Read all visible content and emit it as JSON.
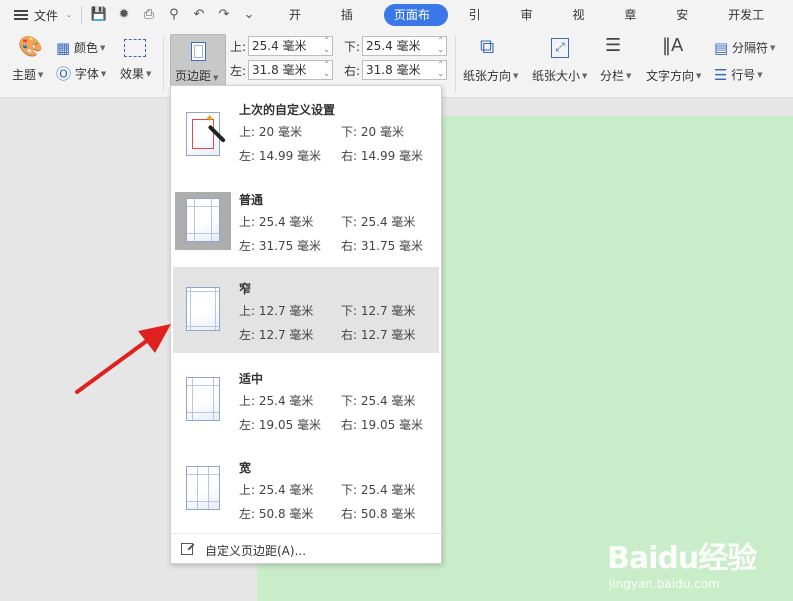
{
  "menubar": {
    "file_label": "文件",
    "tabs": [
      "开始",
      "插入",
      "页面布局",
      "引用",
      "审阅",
      "视图",
      "章节",
      "安全",
      "开发工具"
    ],
    "active_tab": "页面布局"
  },
  "ribbon": {
    "theme": "主题",
    "color": "颜色",
    "font": "字体",
    "effect": "效果",
    "margin": "页边距",
    "top_label": "上:",
    "bottom_label": "下:",
    "left_label": "左:",
    "right_label": "右:",
    "top_value": "25.4 毫米",
    "bottom_value": "25.4 毫米",
    "left_value": "31.8 毫米",
    "right_value": "31.8 毫米",
    "orientation": "纸张方向",
    "size": "纸张大小",
    "columns": "分栏",
    "text_direction": "文字方向",
    "separator": "分隔符",
    "line_number": "行号"
  },
  "dropdown": {
    "options": [
      {
        "title": "上次的自定义设置",
        "top": "上: 20 毫米",
        "bottom": "下: 20 毫米",
        "left": "左: 14.99 毫米",
        "right": "右: 14.99 毫米"
      },
      {
        "title": "普通",
        "top": "上: 25.4 毫米",
        "bottom": "下: 25.4 毫米",
        "left": "左: 31.75 毫米",
        "right": "右: 31.75 毫米"
      },
      {
        "title": "窄",
        "top": "上: 12.7 毫米",
        "bottom": "下: 12.7 毫米",
        "left": "左: 12.7 毫米",
        "right": "右: 12.7 毫米"
      },
      {
        "title": "适中",
        "top": "上: 25.4 毫米",
        "bottom": "下: 25.4 毫米",
        "left": "左: 19.05 毫米",
        "right": "右: 19.05 毫米"
      },
      {
        "title": "宽",
        "top": "上: 25.4 毫米",
        "bottom": "下: 25.4 毫米",
        "left": "左: 50.8 毫米",
        "right": "右: 50.8 毫米"
      }
    ],
    "custom_label": "自定义页边距(A)..."
  },
  "watermark": {
    "brand": "Baidu经验",
    "url": "jingyan.baidu.com"
  },
  "colors": {
    "accent": "#3b78e7",
    "page": "#c9ecc9",
    "arrow": "#e0201e"
  }
}
